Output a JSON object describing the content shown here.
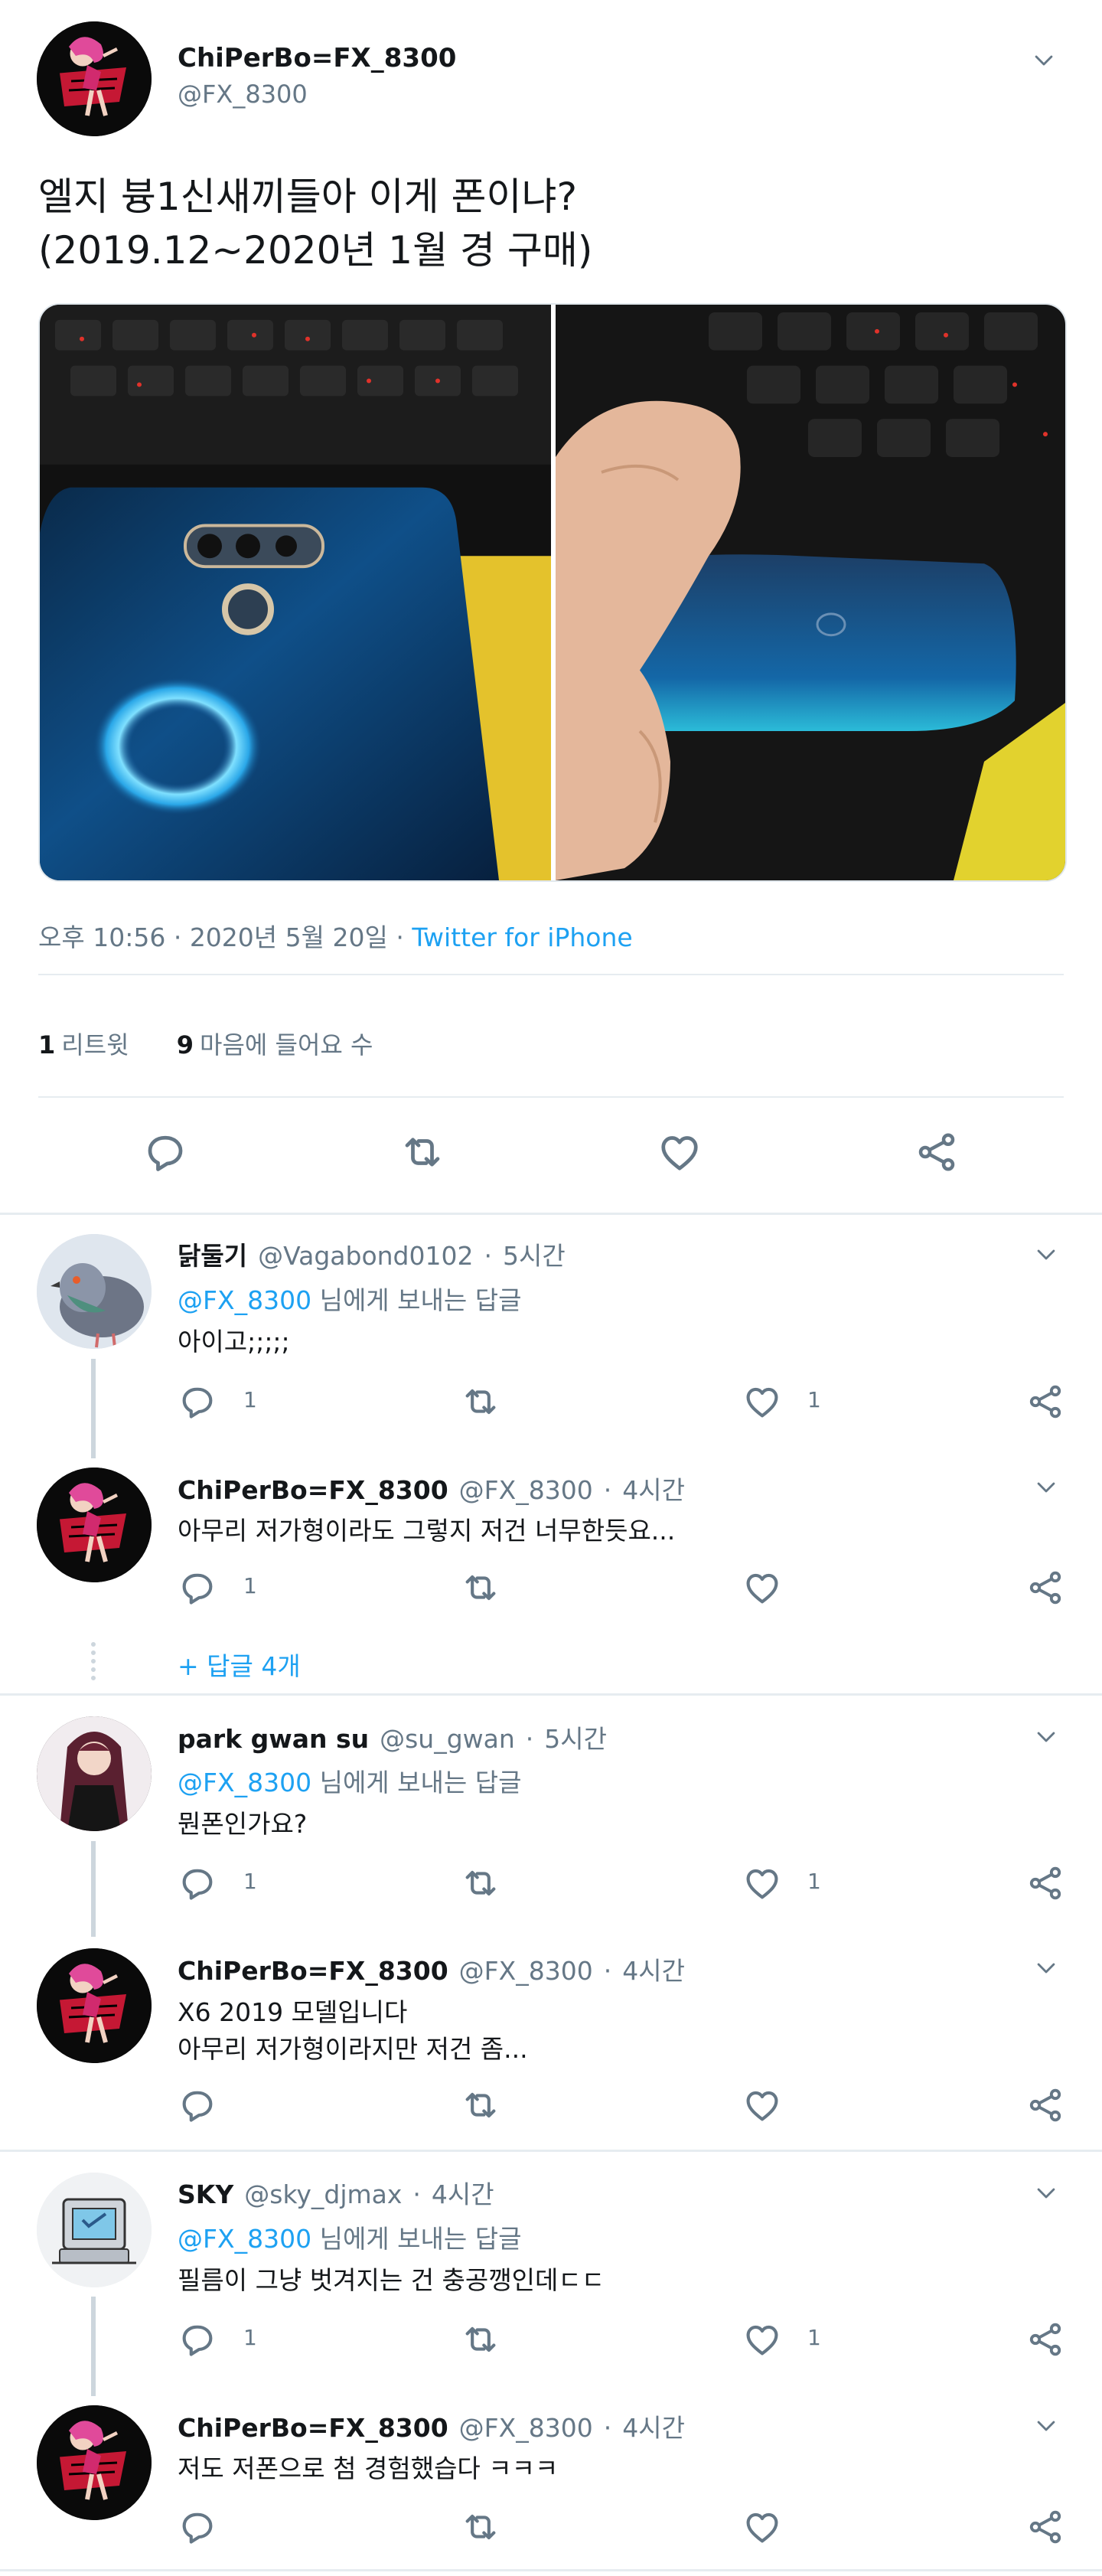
{
  "tweet": {
    "author_name": "ChiPerBo=FX_8300",
    "author_handle": "@FX_8300",
    "text": "엘지 븅1신새끼들아 이게 폰이냐?\n(2019.12~2020년 1월 경 구매)",
    "time": "오후 10:56",
    "date": "2020년 5월 20일",
    "via": "Twitter for iPhone",
    "retweet_count": "1",
    "retweet_label": "리트윗",
    "like_count": "9",
    "like_label": "마음에 들어요 수",
    "meta_sep": "·"
  },
  "replies": [
    {
      "name": "닭둘기",
      "handle": "@Vagabond0102",
      "time": "5시간",
      "reply_to": "@FX_8300",
      "reply_to_suffix": "님에게 보내는 답글",
      "text": "아이고;;;;;",
      "reply_count": "1",
      "like_count": "1"
    },
    {
      "name": "ChiPerBo=FX_8300",
      "handle": "@FX_8300",
      "time": "4시간",
      "text": "아무리 저가형이라도 그렇지 저건 너무한듯요...",
      "reply_count": "1",
      "more_replies": "+ 답글 4개"
    },
    {
      "name": "park gwan su",
      "handle": "@su_gwan",
      "time": "5시간",
      "reply_to": "@FX_8300",
      "reply_to_suffix": "님에게 보내는 답글",
      "text": "뭔폰인가요?",
      "reply_count": "1",
      "like_count": "1"
    },
    {
      "name": "ChiPerBo=FX_8300",
      "handle": "@FX_8300",
      "time": "4시간",
      "text": "X6 2019 모델입니다",
      "text2": "아무리 저가형이라지만 저건 좀..."
    },
    {
      "name": "SKY",
      "handle": "@sky_djmax",
      "time": "4시간",
      "reply_to": "@FX_8300",
      "reply_to_suffix": "님에게 보내는 답글",
      "text": "필름이 그냥 벗겨지는 건 충공깽인데ㄷㄷ",
      "reply_count": "1",
      "like_count": "1"
    },
    {
      "name": "ChiPerBo=FX_8300",
      "handle": "@FX_8300",
      "time": "4시간",
      "text": "저도 저폰으로 첨 경험했습다 ㅋㅋㅋ"
    }
  ],
  "icons": {
    "reply": "reply-icon",
    "retweet": "retweet-icon",
    "like": "heart-icon",
    "share": "share-icon",
    "caret": "chevron-down-icon"
  },
  "colors": {
    "link": "#1da1f2",
    "secondary_text": "#657786",
    "primary_text": "#14171a",
    "divider": "#e6ecf0",
    "icon": "#657786"
  }
}
